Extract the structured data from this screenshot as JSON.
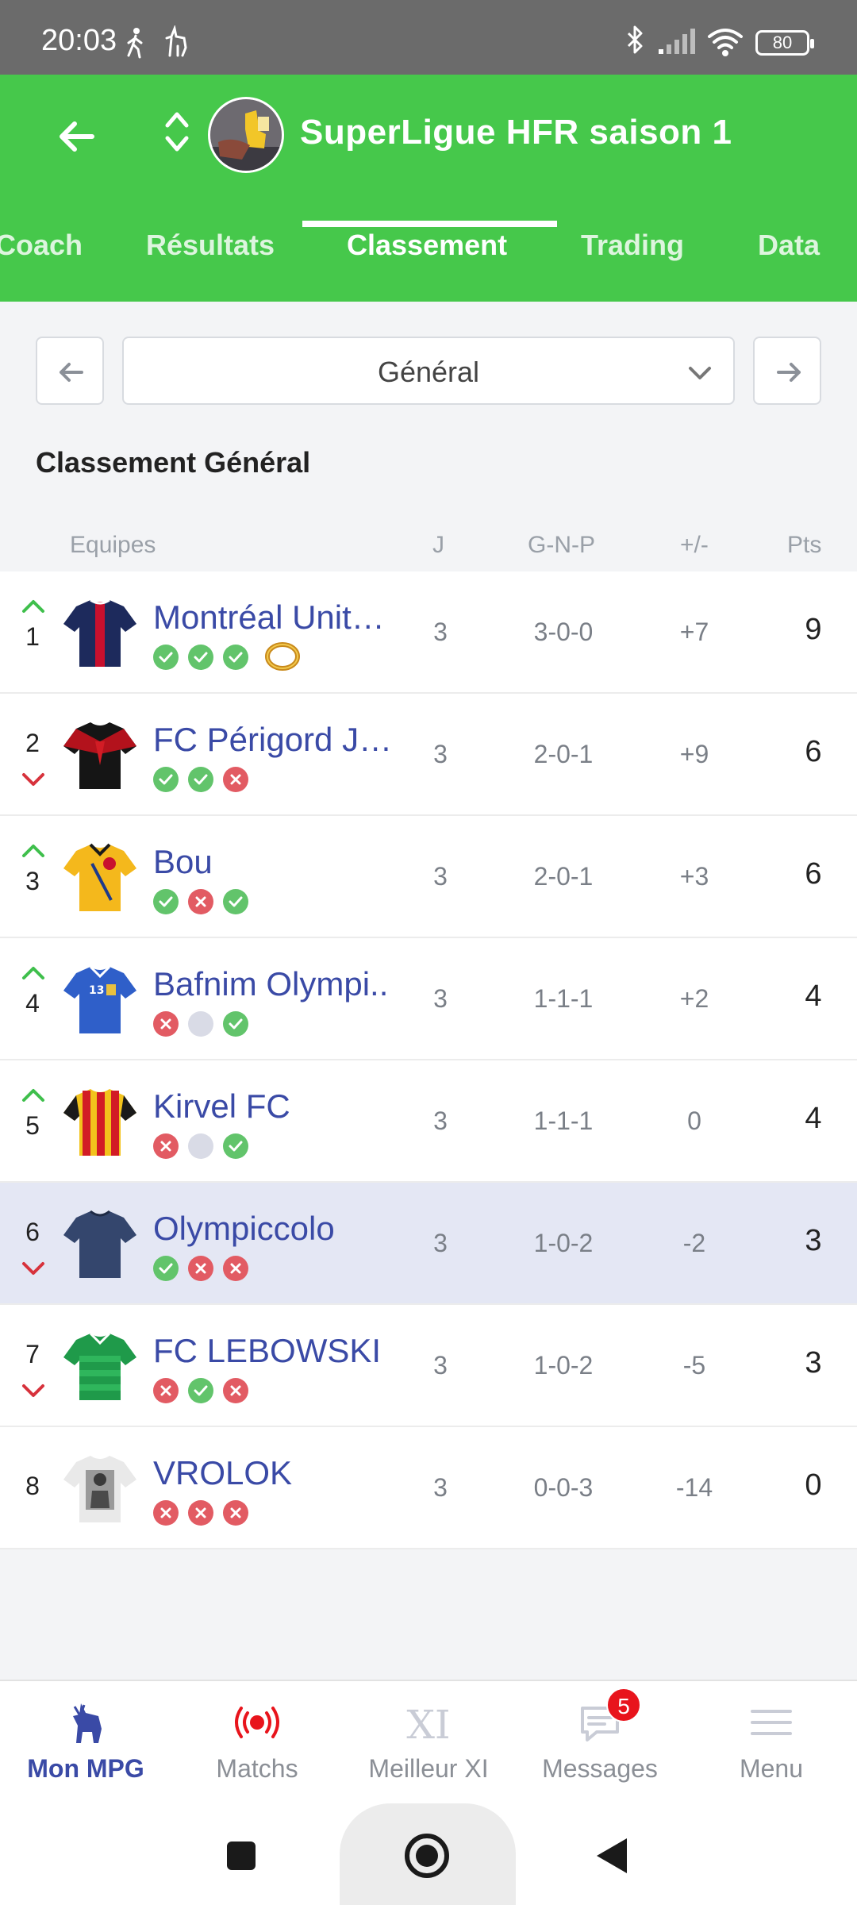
{
  "status_bar": {
    "time": "20:03",
    "battery": "80"
  },
  "header": {
    "title": "SuperLigue HFR saison 1"
  },
  "tabs": [
    {
      "label": "Coach",
      "active": false
    },
    {
      "label": "Résultats",
      "active": false
    },
    {
      "label": "Classement",
      "active": true
    },
    {
      "label": "Trading",
      "active": false
    },
    {
      "label": "Data",
      "active": false
    }
  ],
  "filter": {
    "selected": "Général"
  },
  "section_title": "Classement Général",
  "table": {
    "headers": {
      "team": "Equipes",
      "played": "J",
      "record": "G-N-P",
      "diff": "+/-",
      "points": "Pts"
    },
    "rows": [
      {
        "rank": "1",
        "trend": "up",
        "name": "Montréal Unit…",
        "results": [
          "w",
          "w",
          "w"
        ],
        "played": "3",
        "record": "3-0-0",
        "diff": "+7",
        "points": "9",
        "jersey": "navy-red",
        "trophy": "ring"
      },
      {
        "rank": "2",
        "trend": "down",
        "name": "FC Périgord J…",
        "results": [
          "w",
          "w",
          "l"
        ],
        "played": "3",
        "record": "2-0-1",
        "diff": "+9",
        "points": "6",
        "jersey": "black-red"
      },
      {
        "rank": "3",
        "trend": "up",
        "name": "Bou",
        "results": [
          "w",
          "l",
          "w"
        ],
        "played": "3",
        "record": "2-0-1",
        "diff": "+3",
        "points": "6",
        "jersey": "yellow"
      },
      {
        "rank": "4",
        "trend": "up",
        "name": "Bafnim Olympi..",
        "results": [
          "l",
          "d",
          "w"
        ],
        "played": "3",
        "record": "1-1-1",
        "diff": "+2",
        "points": "4",
        "jersey": "blue-13"
      },
      {
        "rank": "5",
        "trend": "up",
        "name": "Kirvel FC",
        "results": [
          "l",
          "d",
          "w"
        ],
        "played": "3",
        "record": "1-1-1",
        "diff": "0",
        "points": "4",
        "jersey": "red-yellow-stripes"
      },
      {
        "rank": "6",
        "trend": "down",
        "name": "Olympiccolo",
        "results": [
          "w",
          "l",
          "l"
        ],
        "played": "3",
        "record": "1-0-2",
        "diff": "-2",
        "points": "3",
        "jersey": "dark-blue",
        "highlight": true
      },
      {
        "rank": "7",
        "trend": "down",
        "name": "FC LEBOWSKI",
        "results": [
          "l",
          "w",
          "l"
        ],
        "played": "3",
        "record": "1-0-2",
        "diff": "-5",
        "points": "3",
        "jersey": "green-hoops"
      },
      {
        "rank": "8",
        "trend": "none",
        "name": "VROLOK",
        "results": [
          "l",
          "l",
          "l"
        ],
        "played": "3",
        "record": "0-0-3",
        "diff": "-14",
        "points": "0",
        "jersey": "white-photo"
      }
    ]
  },
  "bottom_nav": [
    {
      "label": "Mon MPG",
      "icon": "goat-icon",
      "active": true
    },
    {
      "label": "Matchs",
      "icon": "live-broadcast-icon",
      "active": false
    },
    {
      "label": "Meilleur XI",
      "icon": "xi-icon",
      "active": false
    },
    {
      "label": "Messages",
      "icon": "message-icon",
      "active": false,
      "badge": "5"
    },
    {
      "label": "Menu",
      "icon": "hamburger-icon",
      "active": false
    }
  ],
  "colors": {
    "brand_green": "#46c84b",
    "team_blue": "#3a4aa6",
    "win": "#62c46b",
    "loss": "#e25b63",
    "draw": "#d9dbe6",
    "up": "#3fbf4c",
    "down": "#d7323c",
    "badge": "#e8141c"
  }
}
